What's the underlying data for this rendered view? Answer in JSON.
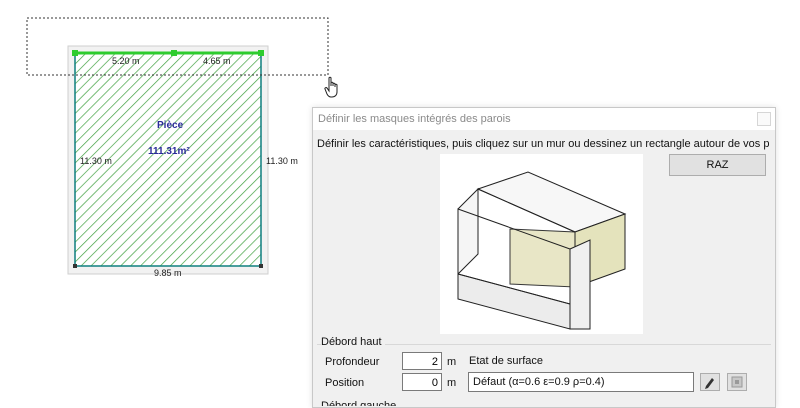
{
  "plan": {
    "dims": {
      "top_left": "5.20 m",
      "top_right": "4.65 m",
      "left": "11.30 m",
      "right": "11.30 m",
      "bottom": "9.85 m"
    },
    "room": {
      "name": "Pièce",
      "area": "111.31m²"
    },
    "colors": {
      "hatch": "#3fa03f",
      "wall": "#0f7f7f",
      "selected_wall": "#2ecc2e"
    }
  },
  "dialog": {
    "title": "Définir les masques intégrés des parois",
    "instruction": "Définir les caractéristiques, puis cliquez sur un mur ou dessinez un rectangle autour de vos p",
    "raz_label": "RAZ",
    "debord_haut": {
      "section_label": "Débord haut",
      "profondeur_label": "Profondeur",
      "profondeur_value": "2",
      "profondeur_unit": "m",
      "position_label": "Position",
      "position_value": "0",
      "position_unit": "m"
    },
    "surface": {
      "label": "Etat de surface",
      "value": "Défaut (α=0.6 ε=0.9 ρ=0.4)"
    },
    "next_section_label": "Débord gauche"
  }
}
